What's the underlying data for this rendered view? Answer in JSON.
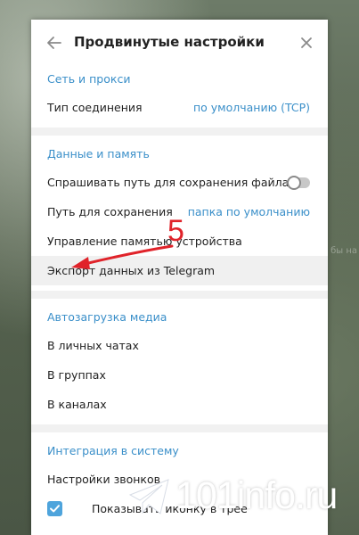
{
  "background": {
    "ghost_text": "бы на"
  },
  "dialog": {
    "title": "Продвинутые настройки",
    "back_icon": "arrow-left-icon",
    "close_icon": "close-icon"
  },
  "sections": {
    "network": {
      "title": "Сеть и прокси",
      "connection_type": {
        "label": "Тип соединения",
        "value": "по умолчанию (TCP)"
      }
    },
    "data": {
      "title": "Данные и память",
      "ask_path": {
        "label": "Спрашивать путь для сохранения файла",
        "toggle_on": false
      },
      "save_path": {
        "label": "Путь для сохранения",
        "value": "папка по умолчанию"
      },
      "storage": {
        "label": "Управление памятью устройства"
      },
      "export": {
        "label": "Экспорт данных из Telegram"
      }
    },
    "autoload": {
      "title": "Автозагрузка медиа",
      "items": [
        "В личных чатах",
        "В группах",
        "В каналах"
      ]
    },
    "integration": {
      "title": "Интеграция в систему",
      "calls": {
        "label": "Настройки звонков"
      },
      "tray_icon": {
        "label": "Показывать иконку в трее",
        "checked": true
      }
    }
  },
  "annotation": {
    "number": "5",
    "color": "#e0232a"
  },
  "watermark": {
    "text": "101info.ru",
    "icon": "telegram-plane-icon"
  },
  "colors": {
    "accent": "#3a8fc9",
    "annotation": "#e0232a"
  }
}
